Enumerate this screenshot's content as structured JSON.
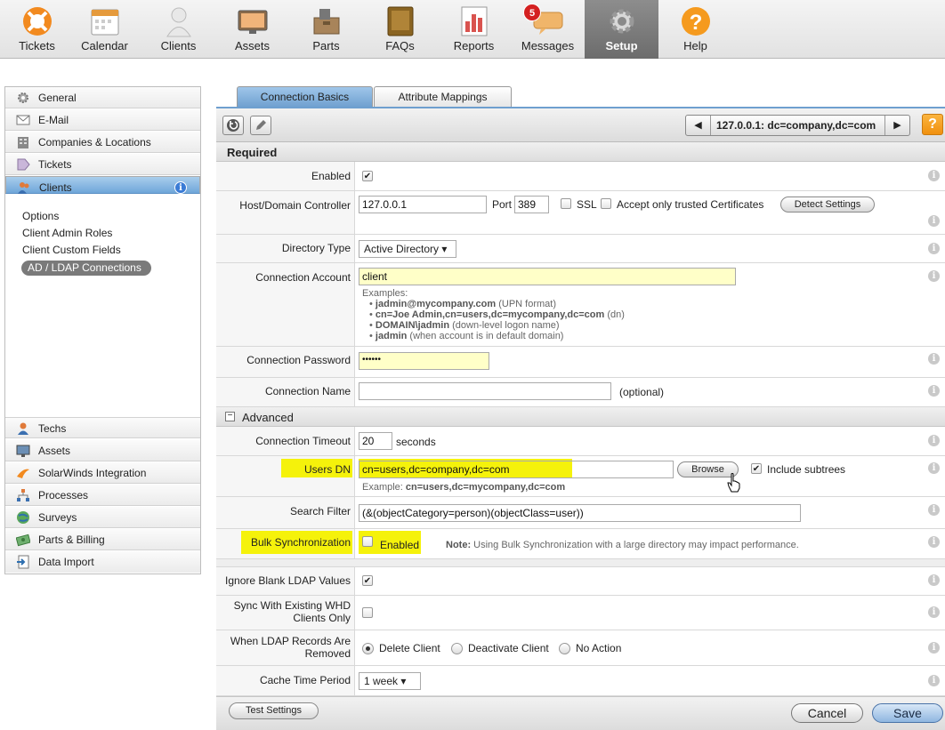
{
  "topnav": {
    "items": [
      {
        "label": "Tickets",
        "icon": "lifebuoy-icon"
      },
      {
        "label": "Calendar",
        "icon": "calendar-icon"
      },
      {
        "label": "Clients",
        "icon": "person-icon"
      },
      {
        "label": "Assets",
        "icon": "monitor-icon"
      },
      {
        "label": "Parts",
        "icon": "parts-box-icon"
      },
      {
        "label": "FAQs",
        "icon": "faq-book-icon"
      },
      {
        "label": "Reports",
        "icon": "report-icon"
      },
      {
        "label": "Messages",
        "icon": "message-bubble-icon"
      },
      {
        "label": "Setup",
        "icon": "gear-icon"
      },
      {
        "label": "Help",
        "icon": "help-question-icon"
      }
    ],
    "messages_badge": "5",
    "active": "Setup"
  },
  "sidebar": {
    "top_items": [
      "General",
      "E-Mail",
      "Companies & Locations",
      "Tickets",
      "Clients"
    ],
    "clients_subitems": [
      "Options",
      "Client Admin Roles",
      "Client Custom Fields",
      "AD / LDAP Connections"
    ],
    "bottom_items": [
      "Techs",
      "Assets",
      "SolarWinds Integration",
      "Processes",
      "Surveys",
      "Parts & Billing",
      "Data Import"
    ],
    "info_badge": "i"
  },
  "tabs": [
    "Connection Basics",
    "Attribute Mappings"
  ],
  "toolbar": {
    "connection_name": "127.0.0.1: dc=company,dc=com",
    "help": "?"
  },
  "sections": {
    "required": "Required",
    "advanced": "Advanced",
    "toggle": "−"
  },
  "form": {
    "enabled_label": "Enabled",
    "host_label": "Host/Domain Controller",
    "host_value": "127.0.0.1",
    "port_label": "Port",
    "port_value": "389",
    "ssl_label": "SSL",
    "trusted_label": "Accept only trusted Certificates",
    "detect_button": "Detect Settings",
    "directory_type_label": "Directory Type",
    "directory_type_value": "Active Directory ▾",
    "account_label": "Connection Account",
    "account_value": "client",
    "examples_heading": "Examples:",
    "examples": [
      {
        "bold": "jadmin@mycompany.com",
        "note": " (UPN format)"
      },
      {
        "bold": "cn=Joe Admin,cn=users,dc=mycompany,dc=com",
        "note": " (dn)"
      },
      {
        "bold": "DOMAIN\\jadmin",
        "note": " (down-level logon name)"
      },
      {
        "bold": "jadmin",
        "note": " (when account is in default domain)"
      }
    ],
    "password_label": "Connection Password",
    "password_value": "••••••",
    "name_label": "Connection Name",
    "name_value": "",
    "optional": "(optional)",
    "timeout_label": "Connection Timeout",
    "timeout_value": "20",
    "seconds": "seconds",
    "users_dn_label": "Users DN",
    "users_dn_value": "cn=users,dc=company,dc=com",
    "browse_button": "Browse",
    "include_subtrees": "Include subtrees",
    "users_dn_example_prefix": "Example: ",
    "users_dn_example": "cn=users,dc=mycompany,dc=com",
    "search_filter_label": "Search Filter",
    "search_filter_value": "(&(objectCategory=person)(objectClass=user))",
    "bulk_label": "Bulk Synchronization",
    "bulk_enabled": "Enabled",
    "bulk_note_bold": "Note:",
    "bulk_note": " Using Bulk Synchronization with a large directory may impact performance.",
    "ignore_blank_label": "Ignore Blank LDAP Values",
    "sync_label_1": "Sync With Existing WHD",
    "sync_label_2": "Clients Only",
    "removed_label_1": "When LDAP Records Are",
    "removed_label_2": "Removed",
    "removed_options": [
      "Delete Client",
      "Deactivate Client",
      "No Action"
    ],
    "cache_label": "Cache Time Period",
    "cache_value": "1 week ▾"
  },
  "footer": {
    "test": "Test Settings",
    "cancel": "Cancel",
    "save": "Save"
  },
  "colors": {
    "highlight": "#f5f20b",
    "active_tab": "#6e9fcf",
    "selected_sidebar": "#6fa6d9"
  }
}
